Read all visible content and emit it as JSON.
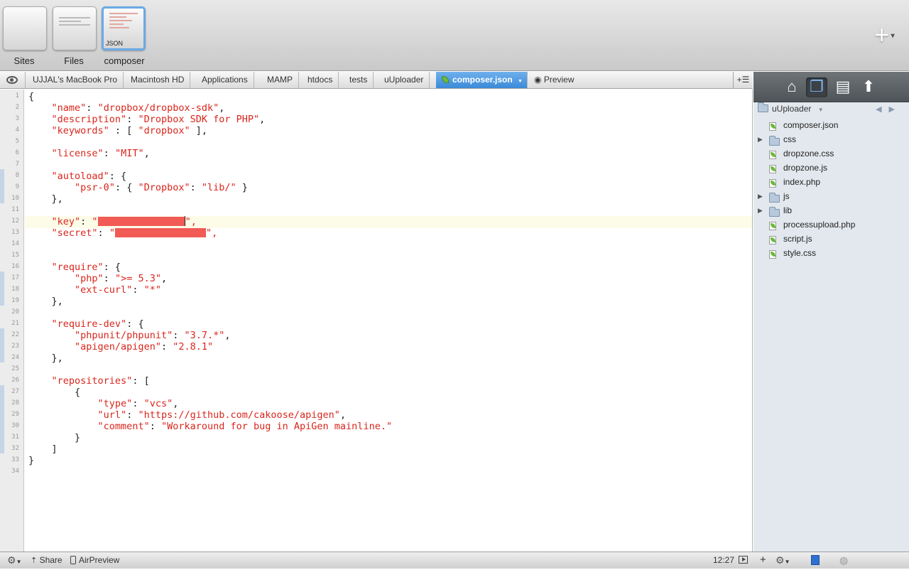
{
  "tabs": [
    {
      "label": "Sites"
    },
    {
      "label": "Files"
    },
    {
      "label": "composer",
      "thumb_text": "JSON"
    }
  ],
  "breadcrumb": [
    "UJJAL's MacBook Pro",
    "Macintosh HD",
    "Applications",
    "MAMP",
    "htdocs",
    "tests",
    "uUploader"
  ],
  "active_file": "composer.json",
  "preview_label": "Preview",
  "editor": {
    "line_numbers": [
      "1",
      "2",
      "3",
      "4",
      "5",
      "6",
      "7",
      "8",
      "9",
      "10",
      "11",
      "12",
      "13",
      "14",
      "15",
      "16",
      "17",
      "18",
      "19",
      "20",
      "21",
      "22",
      "23",
      "24",
      "25",
      "26",
      "27",
      "28",
      "29",
      "30",
      "31",
      "32",
      "33",
      "34"
    ],
    "lines": [
      "{",
      "    \"name\": \"dropbox/dropbox-sdk\",",
      "    \"description\": \"Dropbox SDK for PHP\",",
      "    \"keywords\" : [ \"dropbox\" ],",
      "",
      "    \"license\": \"MIT\",",
      "",
      "    \"autoload\": {",
      "        \"psr-0\": { \"Dropbox\": \"lib/\" }",
      "    },",
      "",
      "    \"key\": \"",
      "    \"secret\": \"",
      "",
      "",
      "    \"require\": {",
      "        \"php\": \">= 5.3\",",
      "        \"ext-curl\": \"*\"",
      "    },",
      "",
      "    \"require-dev\": {",
      "        \"phpunit/phpunit\": \"3.7.*\",",
      "        \"apigen/apigen\": \"2.8.1\"",
      "    },",
      "",
      "    \"repositories\": [",
      "        {",
      "            \"type\": \"vcs\",",
      "            \"url\": \"https://github.com/cakoose/apigen\",",
      "            \"comment\": \"Workaround for bug in ApiGen mainline.\"",
      "        }",
      "    ]",
      "}",
      ""
    ]
  },
  "sidebar": {
    "project": "uUploader",
    "items": [
      {
        "type": "file",
        "name": "composer.json"
      },
      {
        "type": "folder",
        "name": "css"
      },
      {
        "type": "file",
        "name": "dropzone.css"
      },
      {
        "type": "file",
        "name": "dropzone.js"
      },
      {
        "type": "file",
        "name": "index.php"
      },
      {
        "type": "folder",
        "name": "js"
      },
      {
        "type": "folder",
        "name": "lib"
      },
      {
        "type": "file",
        "name": "processupload.php"
      },
      {
        "type": "file",
        "name": "script.js"
      },
      {
        "type": "file",
        "name": "style.css"
      }
    ]
  },
  "statusbar": {
    "share": "Share",
    "airpreview": "AirPreview",
    "cursor_pos": "12:27"
  },
  "colors": {
    "string": "#d9261c",
    "accent": "#3a8ad8",
    "redaction": "#f15a55",
    "sidebar_bg": "#e3e8ee"
  }
}
